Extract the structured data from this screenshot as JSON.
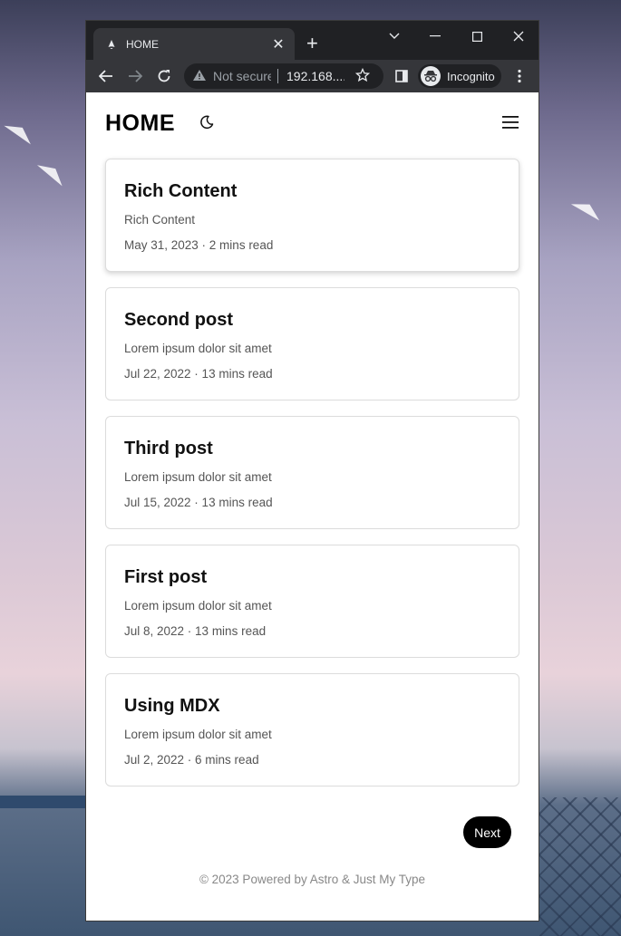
{
  "browser": {
    "tab_title": "HOME",
    "omnibox_security": "Not secure",
    "omnibox_url": "192.168....",
    "profile_label": "Incognito"
  },
  "site": {
    "title": "HOME"
  },
  "posts": [
    {
      "title": "Rich Content",
      "description": "Rich Content",
      "meta": "May 31, 2023 · 2 mins read"
    },
    {
      "title": "Second post",
      "description": "Lorem ipsum dolor sit amet",
      "meta": "Jul 22, 2022 · 13 mins read"
    },
    {
      "title": "Third post",
      "description": "Lorem ipsum dolor sit amet",
      "meta": "Jul 15, 2022 · 13 mins read"
    },
    {
      "title": "First post",
      "description": "Lorem ipsum dolor sit amet",
      "meta": "Jul 8, 2022 · 13 mins read"
    },
    {
      "title": "Using MDX",
      "description": "Lorem ipsum dolor sit amet",
      "meta": "Jul 2, 2022 · 6 mins read"
    }
  ],
  "pagination": {
    "next_label": "Next"
  },
  "footer": {
    "text": "© 2023 Powered by Astro & Just My Type"
  }
}
